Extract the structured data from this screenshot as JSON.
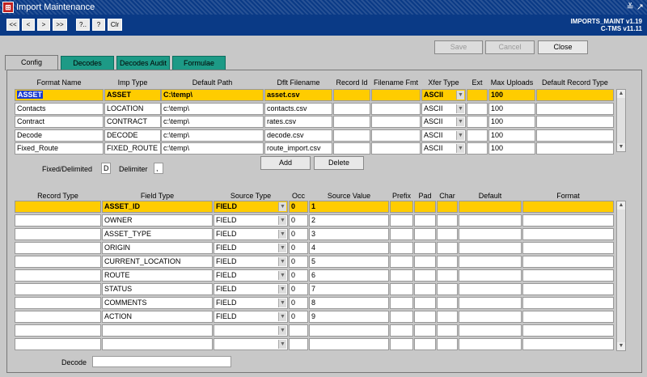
{
  "window": {
    "title": "Import Maintenance",
    "icon": "app-icon",
    "controls": "≚ ↗"
  },
  "nav": [
    "<<",
    "<",
    ">",
    ">>",
    "?..",
    "?",
    "Clr"
  ],
  "header_right": {
    "line1": "IMPORTS_MAINT v1.19",
    "line2": "C-TMS v11.11"
  },
  "actions": {
    "save": "Save",
    "cancel": "Cancel",
    "close": "Close"
  },
  "tabs": [
    "Config",
    "Decodes",
    "Decodes Audit",
    "Formulae"
  ],
  "top_table": {
    "headers": [
      "Format Name",
      "Imp Type",
      "Default Path",
      "Dflt Filename",
      "Record Id",
      "Filename Fmt",
      "Xfer Type",
      "Ext",
      "Max Uploads",
      "Default Record Type"
    ],
    "rows": [
      {
        "format": "ASSET",
        "imp": "ASSET",
        "path": "C:\\temp\\",
        "file": "asset.csv",
        "xfer": "ASCII",
        "max": "100"
      },
      {
        "format": "Contacts",
        "imp": "LOCATION",
        "path": "c:\\temp\\",
        "file": "contacts.csv",
        "xfer": "ASCII",
        "max": "100"
      },
      {
        "format": "Contract",
        "imp": "CONTRACT",
        "path": "c:\\temp\\",
        "file": "rates.csv",
        "xfer": "ASCII",
        "max": "100"
      },
      {
        "format": "Decode",
        "imp": "DECODE",
        "path": "c:\\temp\\",
        "file": "decode.csv",
        "xfer": "ASCII",
        "max": "100"
      },
      {
        "format": "Fixed_Route",
        "imp": "FIXED_ROUTE",
        "path": "c:\\temp\\",
        "file": "route_import.csv",
        "xfer": "ASCII",
        "max": "100"
      }
    ]
  },
  "fixed_label": "Fixed/Delimited",
  "fixed_value": "D",
  "delim_label": "Delimiter",
  "delim_value": ",",
  "mid_buttons": {
    "add": "Add",
    "delete": "Delete"
  },
  "bottom_table": {
    "headers": [
      "Record Type",
      "Field Type",
      "Source Type",
      "Occ",
      "Source Value",
      "Prefix",
      "Pad",
      "Char",
      "Default",
      "Format"
    ],
    "rows": [
      {
        "field": "ASSET_ID",
        "src": "FIELD",
        "occ": "0",
        "val": "1"
      },
      {
        "field": "OWNER",
        "src": "FIELD",
        "occ": "0",
        "val": "2"
      },
      {
        "field": "ASSET_TYPE",
        "src": "FIELD",
        "occ": "0",
        "val": "3"
      },
      {
        "field": "ORIGIN",
        "src": "FIELD",
        "occ": "0",
        "val": "4"
      },
      {
        "field": "CURRENT_LOCATION",
        "src": "FIELD",
        "occ": "0",
        "val": "5"
      },
      {
        "field": "ROUTE",
        "src": "FIELD",
        "occ": "0",
        "val": "6"
      },
      {
        "field": "STATUS",
        "src": "FIELD",
        "occ": "0",
        "val": "7"
      },
      {
        "field": "COMMENTS",
        "src": "FIELD",
        "occ": "0",
        "val": "8"
      },
      {
        "field": "ACTION",
        "src": "FIELD",
        "occ": "0",
        "val": "9"
      },
      {
        "field": "",
        "src": "",
        "occ": "",
        "val": ""
      },
      {
        "field": "",
        "src": "",
        "occ": "",
        "val": ""
      }
    ]
  },
  "decode_label": "Decode"
}
